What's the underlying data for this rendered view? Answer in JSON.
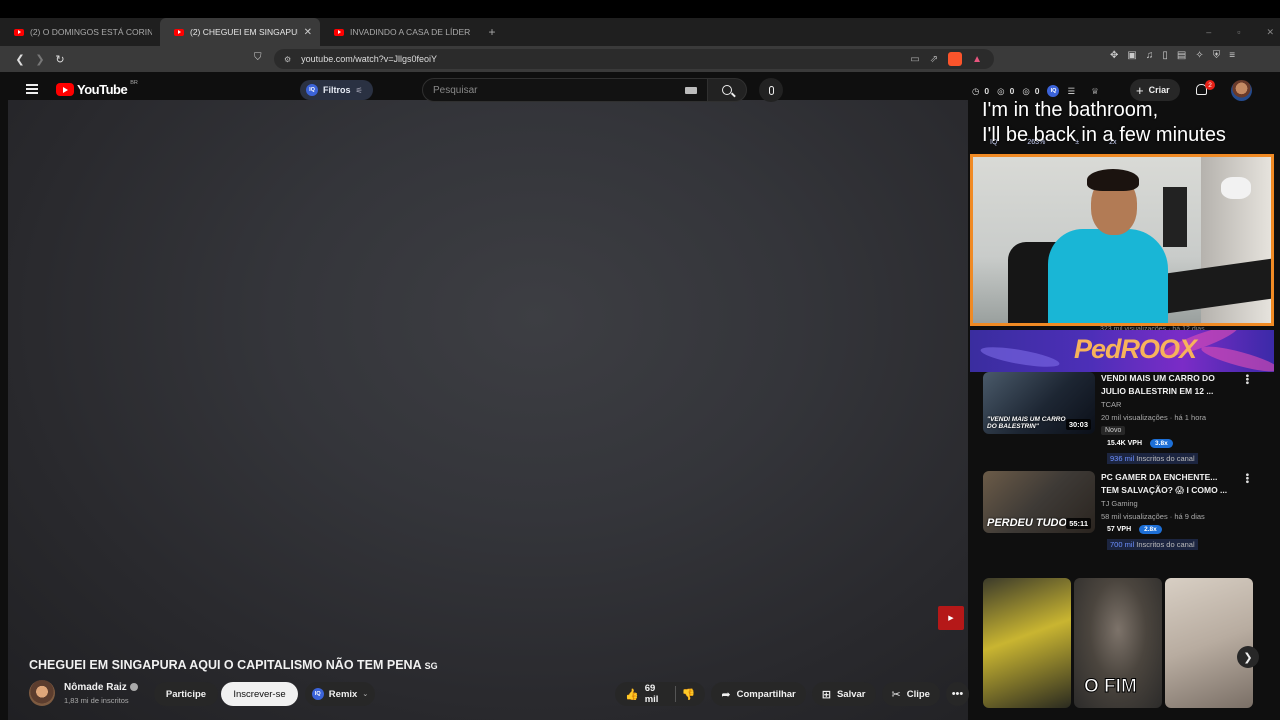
{
  "browser": {
    "tabs": [
      {
        "title": "(2) O DOMINGOS ESTÁ CORINGANDO",
        "active": false
      },
      {
        "title": "(2) CHEGUEI EM SINGAPURA AQUI O",
        "active": true
      },
      {
        "title": "INVADINDO A CASA DE LÍDER DO CARTEL",
        "active": false
      }
    ],
    "new_tab": "+",
    "url": "youtube.com/watch?v=Jllgs0feoiY",
    "window_controls": [
      "–",
      "▫",
      "✕"
    ]
  },
  "masthead": {
    "logo": "YouTube",
    "region": "BR",
    "filter_label": "Filtros",
    "search_placeholder": "Pesquisar",
    "stats": [
      "0",
      "0",
      "0"
    ],
    "create_label": "Criar",
    "notifications_count": "2"
  },
  "overlay": {
    "caption_line1": "I'm in the bathroom,",
    "caption_line2": "I'll be back in a few minutes",
    "hidden_row": [
      "IQ",
      "263%",
      "±",
      "2x"
    ],
    "hidden_meta": "323 mil visualizações · há 12 dias",
    "banner_text": "PedROOX"
  },
  "recommendations": [
    {
      "title": "VENDI MAIS UM CARRO DO JULIO BALESTRIN EM 12 ...",
      "channel": "TCAR",
      "meta": "20 mil visualizações · há 1 hora",
      "badge": "Novo",
      "vph": "15.4K VPH",
      "multiplier": "3.8x",
      "subs_num": "936 mil",
      "subs_label": " Inscritos do canal",
      "duration": "30:03",
      "thumb_text": "\"VENDI MAIS UM CARRO DO BALESTRIN\""
    },
    {
      "title": "PC GAMER DA ENCHENTE... TEM SALVAÇÃO? 😱 I COMO ...",
      "channel": "TJ Gaming",
      "meta": "58 mil visualizações · há 9 dias",
      "vph": "57 VPH",
      "multiplier": "2.8x",
      "subs_num": "700 mil",
      "subs_label": " Inscritos do canal",
      "duration": "55:11",
      "thumb_text": "PERDEU TUDO"
    }
  ],
  "shorts": [
    {
      "text": "O FIM"
    }
  ],
  "video": {
    "title": "CHEGUEI EM SINGAPURA AQUI O CAPITALISMO NÃO TEM PENA",
    "title_flag": "SG",
    "channel": "Nômade Raiz",
    "subscribers": "1,83 mi de inscritos",
    "join_label": "Participe",
    "subscribe_label": "Inscrever-se",
    "remix_label": "Remix",
    "likes": "69 mil",
    "share_label": "Compartilhar",
    "save_label": "Salvar",
    "clip_label": "Clipe",
    "more": "•••"
  },
  "colors": {
    "yt_red": "#ff0000",
    "cam_border": "#f08a24",
    "iq_blue": "#3b63d9"
  }
}
